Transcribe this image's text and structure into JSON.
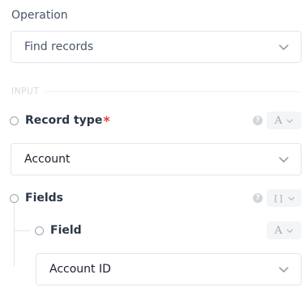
{
  "operation": {
    "label": "Operation",
    "selected": "Find records"
  },
  "section": {
    "label": "INPUT"
  },
  "record_type": {
    "label": "Record type",
    "required_mark": "*",
    "type_glyph": "A",
    "value": "Account"
  },
  "fields": {
    "label": "Fields",
    "type_glyph": "[]",
    "field": {
      "label": "Field",
      "type_glyph": "A",
      "value": "Account ID"
    }
  },
  "help_glyph": "?",
  "colors": {
    "required": "#e53e3e",
    "border": "#e2e6ea",
    "muted": "#a0aab4"
  },
  "icons": [
    "chevron-down-icon",
    "help-icon",
    "radio-icon"
  ]
}
